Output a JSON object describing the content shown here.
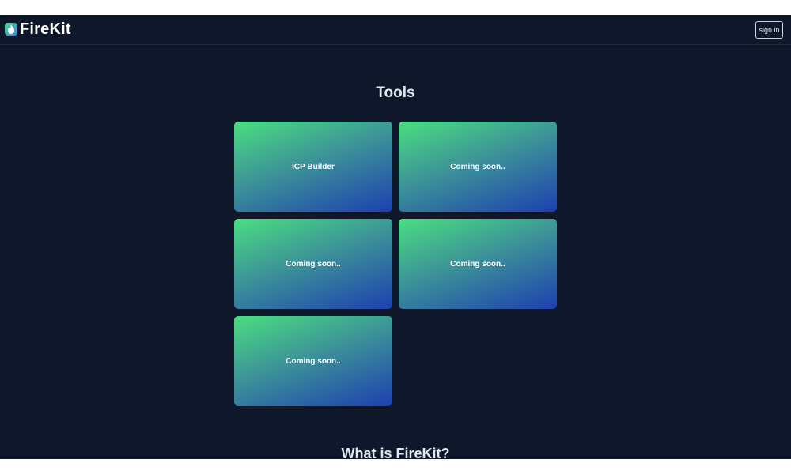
{
  "header": {
    "brand": "FireKit",
    "brand_icon": "flame-icon",
    "signin_label": "sign in"
  },
  "tools": {
    "title": "Tools",
    "cards": [
      {
        "label": "ICP Builder"
      },
      {
        "label": "Coming soon.."
      },
      {
        "label": "Coming soon.."
      },
      {
        "label": "Coming soon.."
      },
      {
        "label": "Coming soon.."
      }
    ]
  },
  "about": {
    "title": "What is FireKit?"
  },
  "colors": {
    "background": "#0f172a",
    "gradient_start": "#4ade80",
    "gradient_end": "#1e40af",
    "text": "#e2e8f0"
  }
}
